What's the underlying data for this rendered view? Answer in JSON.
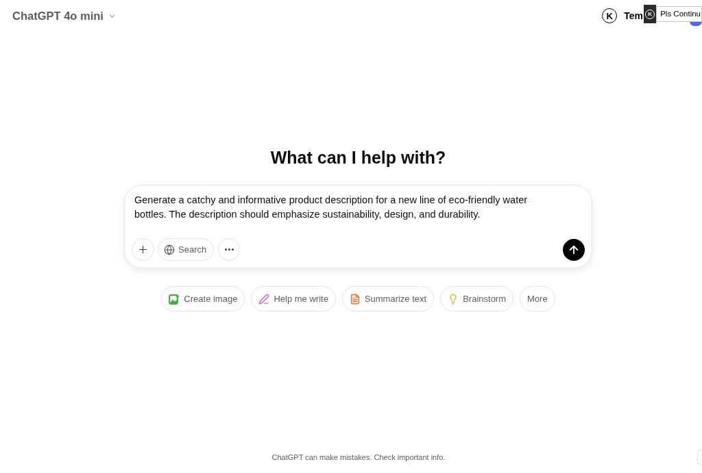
{
  "header": {
    "model_selector": "ChatGPT 4o mini",
    "account_badge": "K",
    "account_label": "Tem"
  },
  "extension_popup": {
    "badge": "K",
    "text": "Pls Continu"
  },
  "heading": "What can I help with?",
  "composer": {
    "value": "Generate a catchy and informative product description for a new line of eco-friendly water bottles. The description should emphasize sustainability, design, and durability.",
    "search_label": "Search"
  },
  "suggestions": [
    {
      "kind": "image",
      "label": "Create image",
      "color": "#3fae49"
    },
    {
      "kind": "write",
      "label": "Help me write",
      "color": "#c67fd1"
    },
    {
      "kind": "summarize",
      "label": "Summarize text",
      "color": "#e67c3d"
    },
    {
      "kind": "brainstorm",
      "label": "Brainstorm",
      "color": "#e3c145"
    },
    {
      "kind": "more",
      "label": "More"
    }
  ],
  "footer": "ChatGPT can make mistakes. Check important info."
}
